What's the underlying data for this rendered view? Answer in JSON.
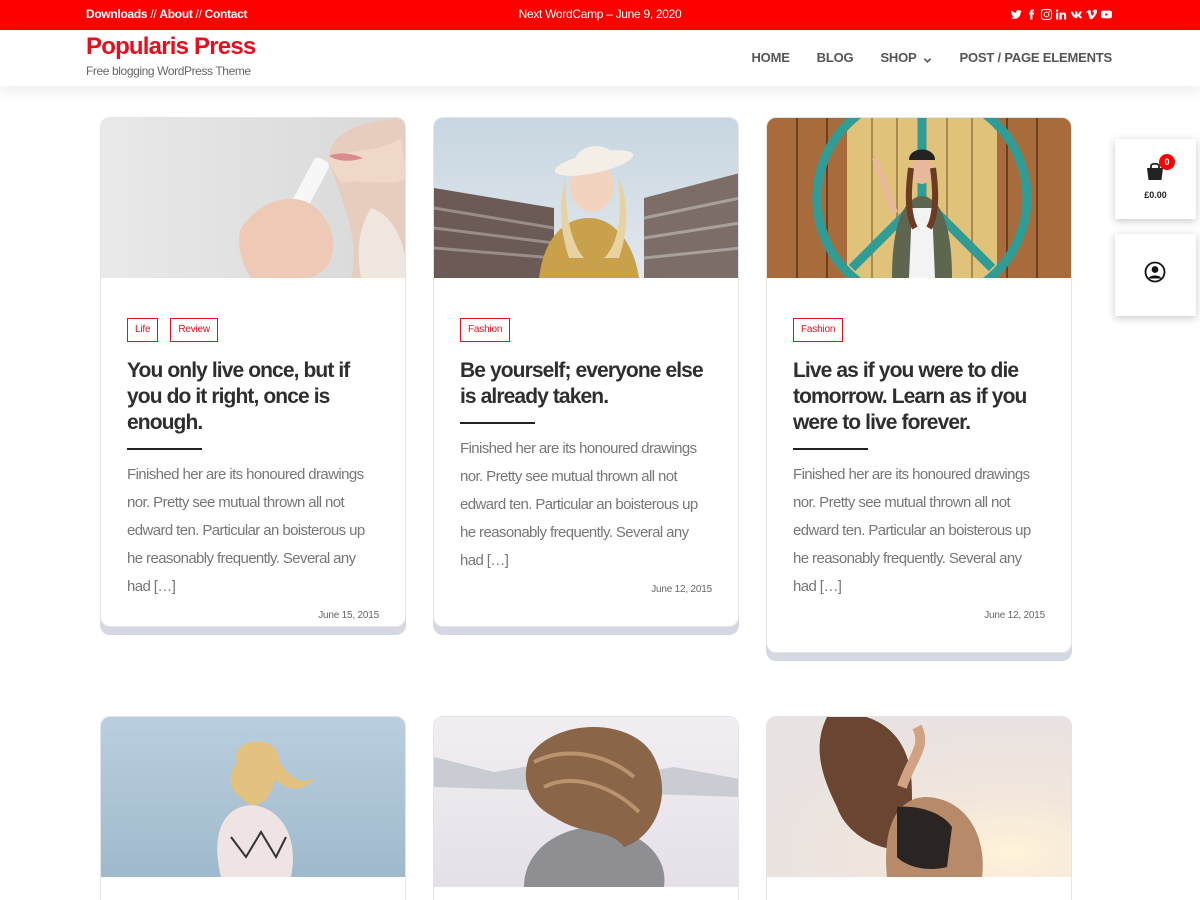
{
  "topbar": {
    "links": [
      "Downloads",
      "About",
      "Contact"
    ],
    "separator": "//",
    "announcement": "Next WordCamp – June 9, 2020",
    "social_icons": [
      "twitter-icon",
      "facebook-icon",
      "instagram-icon",
      "linkedin-icon",
      "vk-icon",
      "vimeo-icon",
      "youtube-icon"
    ],
    "background_color": "#ff0000"
  },
  "header": {
    "site_title": "Popularis Press",
    "tagline": "Free blogging WordPress Theme",
    "title_color": "#ea0d1b"
  },
  "nav": {
    "items": [
      "HOME",
      "BLOG",
      "SHOP",
      "POST / PAGE ELEMENTS"
    ],
    "dropdown_icon": "chevron-down-icon"
  },
  "posts": [
    {
      "tags": [
        "Life",
        "Review"
      ],
      "title": "You only live once, but if you do it right, once is enough.",
      "excerpt": "Finished her are its honoured drawings nor. Pretty see mutual thrown all not edward ten. Particular an boisterous up he reasonably frequently. Several any had […]",
      "date": "June 15, 2015",
      "image": "woman-applying-lip-balm"
    },
    {
      "tags": [
        "Fashion"
      ],
      "title": "Be yourself; everyone else is already taken.",
      "excerpt": "Finished her are its honoured drawings nor. Pretty see mutual thrown all not edward ten. Particular an boisterous up he reasonably frequently. Several any had […]",
      "date": "June 12, 2015",
      "image": "woman-in-hat-on-bridge"
    },
    {
      "tags": [
        "Fashion"
      ],
      "title": "Live as if you were to die tomorrow. Learn as if you were to live forever.",
      "excerpt": "Finished her are its honoured drawings nor. Pretty see mutual thrown all not edward ten. Particular an boisterous up he reasonably frequently. Several any had […]",
      "date": "June 12, 2015",
      "image": "woman-peace-sign-wall"
    },
    {
      "image": "woman-blonde-hair-sky"
    },
    {
      "image": "woman-hair-in-wind-snow"
    },
    {
      "image": "woman-in-sunlight"
    }
  ],
  "cart": {
    "count": "0",
    "total": "£0.00",
    "icon": "shopping-bag-icon"
  },
  "account": {
    "icon": "user-account-icon"
  },
  "colors": {
    "accent": "#ea0d1b",
    "card_shadow": "#d5d7e3"
  }
}
